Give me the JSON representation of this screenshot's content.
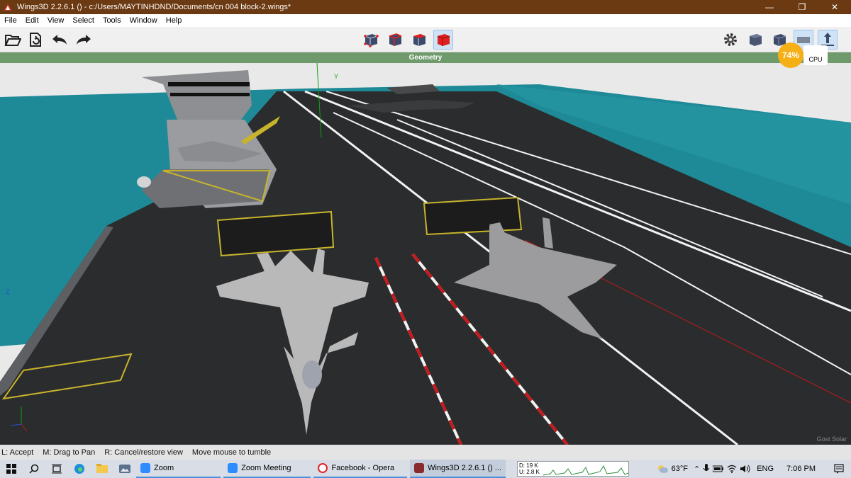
{
  "window": {
    "title": "Wings3D 2.2.6.1 () - c:/Users/MAYTINHDND/Documents/cn 004 block-2.wings*",
    "controls": [
      "—",
      "❐",
      "✕"
    ]
  },
  "menu": [
    "File",
    "Edit",
    "View",
    "Select",
    "Tools",
    "Window",
    "Help"
  ],
  "toolbar": {
    "left": [
      "open-icon",
      "save-icon",
      "undo-icon",
      "redo-icon"
    ],
    "select_modes": [
      "vertex-mode",
      "edge-mode",
      "face-mode",
      "body-mode"
    ],
    "active_mode": "body-mode",
    "right": [
      "settings-icon",
      "smooth-view-icon",
      "wireframe-icon",
      "groundplane-icon",
      "axis-up-icon"
    ]
  },
  "geometry_header": "Geometry",
  "viewport": {
    "axis_labels": {
      "y": "Y",
      "z": "Z"
    },
    "colors": {
      "sky": "#e9e9e9",
      "sea": "#1f8a97",
      "deck": "#2b2c2e",
      "lines": "#f2f2f2",
      "red_lines": "#c8191c",
      "yellow": "#c7b42c",
      "jets": "#b9b9b9"
    }
  },
  "cpu_widget": {
    "percent": "74%",
    "label": "CPU"
  },
  "status_bar": [
    "L: Accept",
    "M: Drag to Pan",
    "R: Cancel/restore view",
    "Move mouse to tumble"
  ],
  "watermark": "Gost Solar",
  "taskbar": {
    "apps": [
      {
        "label": "Zoom",
        "color": "#2d8cff"
      },
      {
        "label": "Zoom Meeting",
        "color": "#2d8cff"
      },
      {
        "label": "Facebook - Opera",
        "color": "#e0242a"
      },
      {
        "label": "Wings3D 2.2.6.1 () ...",
        "color": "#8a2b2b"
      }
    ],
    "net": {
      "down": "D: 19 K",
      "up": "U: 2.8 K"
    },
    "weather": "63°F",
    "language": "ENG",
    "time": "7:06 PM"
  }
}
